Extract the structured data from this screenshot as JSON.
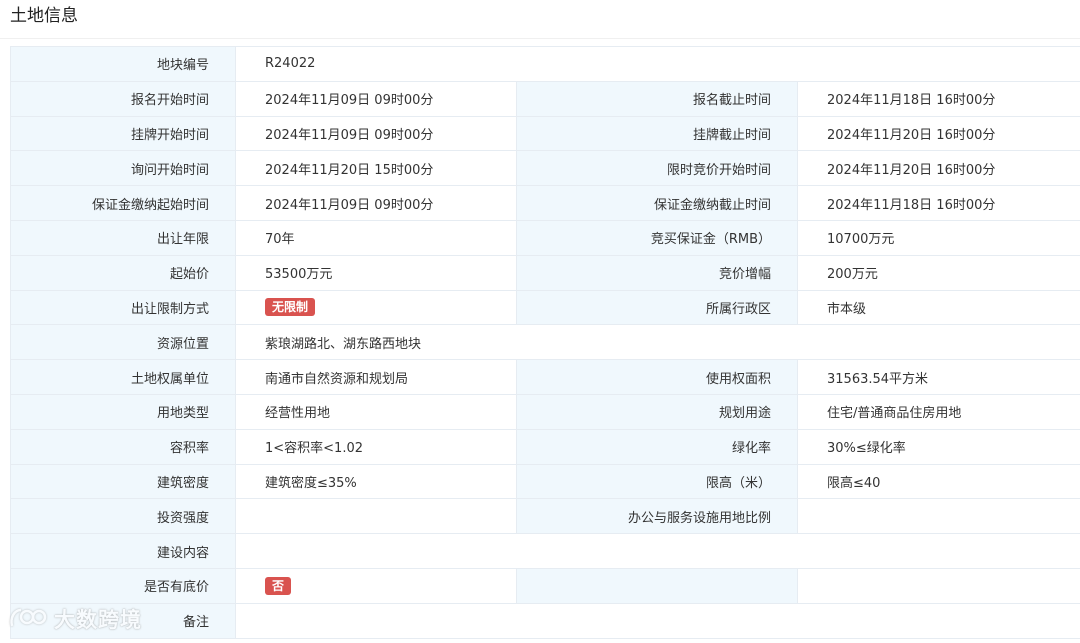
{
  "page": {
    "title": "土地信息"
  },
  "rows": {
    "parcel_no": {
      "label": "地块编号",
      "value": "R24022"
    },
    "reg_start": {
      "label": "报名开始时间",
      "value": "2024年11月09日 09时00分"
    },
    "reg_end": {
      "label": "报名截止时间",
      "value": "2024年11月18日 16时00分"
    },
    "list_start": {
      "label": "挂牌开始时间",
      "value": "2024年11月09日 09时00分"
    },
    "list_end": {
      "label": "挂牌截止时间",
      "value": "2024年11月20日 16时00分"
    },
    "inquiry_start": {
      "label": "询问开始时间",
      "value": "2024年11月20日 15时00分"
    },
    "timed_bid_start": {
      "label": "限时竞价开始时间",
      "value": "2024年11月20日 16时00分"
    },
    "deposit_start": {
      "label": "保证金缴纳起始时间",
      "value": "2024年11月09日 09时00分"
    },
    "deposit_end": {
      "label": "保证金缴纳截止时间",
      "value": "2024年11月18日 16时00分"
    },
    "term": {
      "label": "出让年限",
      "value": "70年"
    },
    "bid_deposit": {
      "label": "竞买保证金（RMB）",
      "value": "10700万元"
    },
    "start_price": {
      "label": "起始价",
      "value": "53500万元"
    },
    "bid_increment": {
      "label": "竞价增幅",
      "value": "200万元"
    },
    "restriction": {
      "label": "出让限制方式",
      "value": "无限制"
    },
    "district": {
      "label": "所属行政区",
      "value": "市本级"
    },
    "location": {
      "label": "资源位置",
      "value": "紫琅湖路北、湖东路西地块"
    },
    "owner_unit": {
      "label": "土地权属单位",
      "value": "南通市自然资源和规划局"
    },
    "area": {
      "label": "使用权面积",
      "value": "31563.54平方米"
    },
    "land_type": {
      "label": "用地类型",
      "value": "经营性用地"
    },
    "planned_use": {
      "label": "规划用途",
      "value": "住宅/普通商品住房用地"
    },
    "far": {
      "label": "容积率",
      "value": "1<容积率<1.02"
    },
    "green_rate": {
      "label": "绿化率",
      "value": "30%≤绿化率"
    },
    "density": {
      "label": "建筑密度",
      "value": "建筑密度≤35%"
    },
    "height_limit": {
      "label": "限高（米）",
      "value": "限高≤40"
    },
    "investment": {
      "label": "投资强度",
      "value": ""
    },
    "office_ratio": {
      "label": "办公与服务设施用地比例",
      "value": ""
    },
    "construction": {
      "label": "建设内容",
      "value": ""
    },
    "reserve_price": {
      "label": "是否有底价",
      "value": "否"
    },
    "remarks": {
      "label": "备注",
      "value": ""
    }
  },
  "watermark": {
    "text": "大数跨境",
    "icon": "brand-logo-icon"
  },
  "colors": {
    "label_bg": "#f0f8fd",
    "border": "#e6ecf2",
    "badge_red": "#d9534f"
  }
}
